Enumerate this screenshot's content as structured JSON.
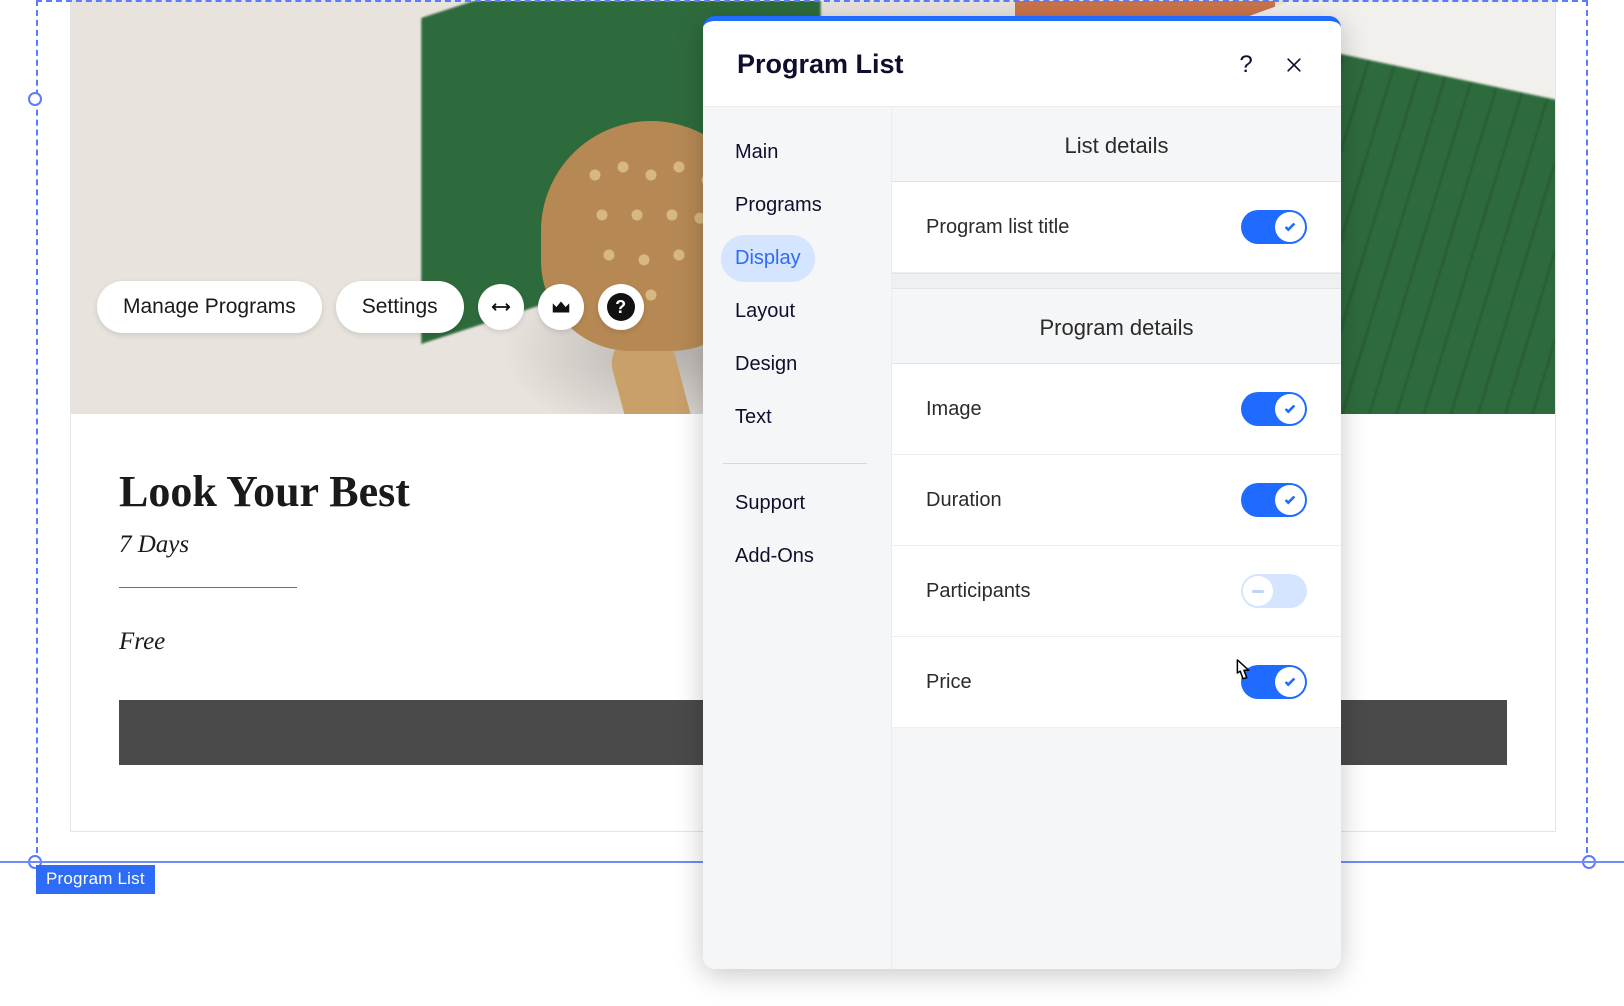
{
  "selection_tag": "Program List",
  "toolbar": {
    "manage_label": "Manage Programs",
    "settings_label": "Settings"
  },
  "card": {
    "title": "Look Your Best",
    "duration": "7 Days",
    "price": "Free"
  },
  "panel": {
    "title": "Program List",
    "sidebar": {
      "items": [
        {
          "label": "Main"
        },
        {
          "label": "Programs"
        },
        {
          "label": "Display"
        },
        {
          "label": "Layout"
        },
        {
          "label": "Design"
        },
        {
          "label": "Text"
        }
      ],
      "extra": [
        {
          "label": "Support"
        },
        {
          "label": "Add-Ons"
        }
      ],
      "active_index": 2
    },
    "sections": {
      "list_details": {
        "heading": "List details",
        "rows": [
          {
            "label": "Program list title",
            "on": true
          }
        ]
      },
      "program_details": {
        "heading": "Program details",
        "rows": [
          {
            "label": "Image",
            "on": true
          },
          {
            "label": "Duration",
            "on": true
          },
          {
            "label": "Participants",
            "on": false
          },
          {
            "label": "Price",
            "on": true
          }
        ]
      }
    }
  }
}
